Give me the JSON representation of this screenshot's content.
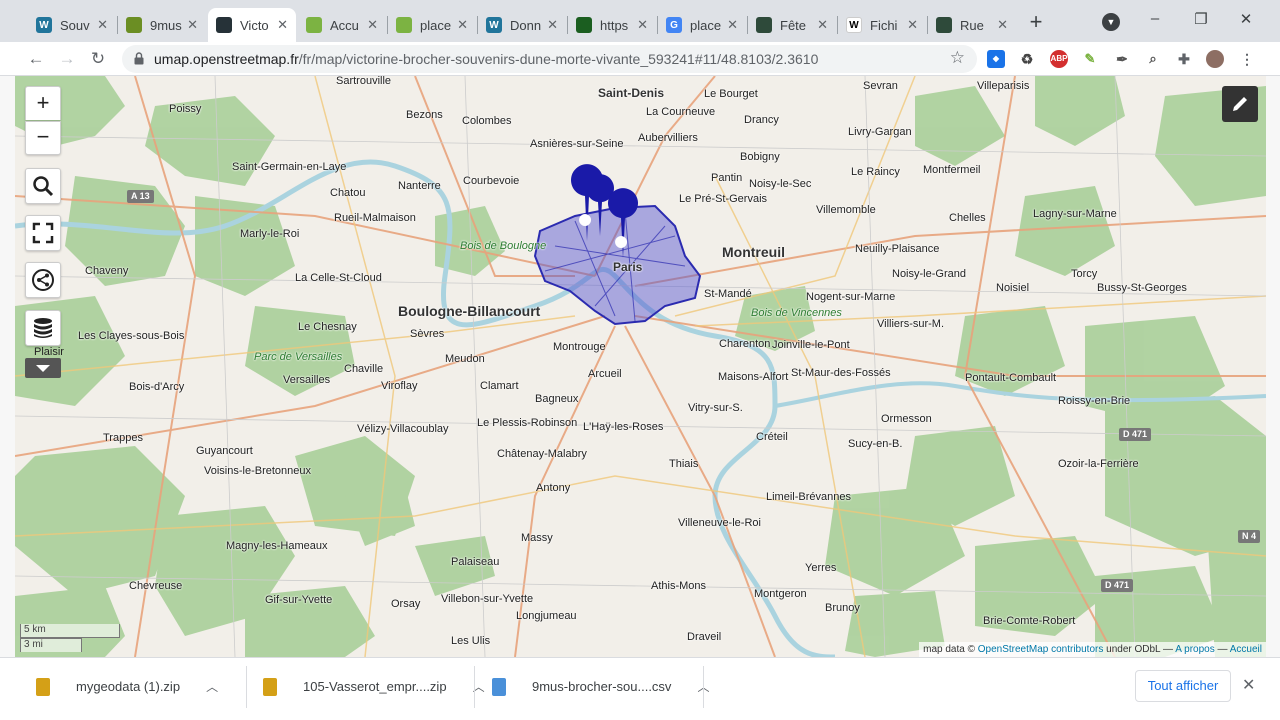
{
  "tabs": [
    {
      "title": "Souv",
      "icon": "wordpress-icon",
      "color": "#21759b",
      "glyph": "W",
      "active": false
    },
    {
      "title": "9mus",
      "icon": "spreadsheet-icon",
      "color": "#6b8e23",
      "glyph": "",
      "active": false
    },
    {
      "title": "Victo",
      "icon": "umap-icon",
      "color": "#263238",
      "glyph": "",
      "active": true
    },
    {
      "title": "Accu",
      "icon": "pin-icon",
      "color": "#7cb342",
      "glyph": "",
      "active": false
    },
    {
      "title": "place",
      "icon": "pin-icon",
      "color": "#7cb342",
      "glyph": "",
      "active": false
    },
    {
      "title": "Donn",
      "icon": "wordpress-icon",
      "color": "#21759b",
      "glyph": "W",
      "active": false
    },
    {
      "title": "https",
      "icon": "check-icon",
      "color": "#1b5e20",
      "glyph": "",
      "active": false
    },
    {
      "title": "place",
      "icon": "google-icon",
      "color": "#4285f4",
      "glyph": "G",
      "active": false
    },
    {
      "title": "Fête",
      "icon": "site-icon",
      "color": "#2e4a3a",
      "glyph": "",
      "active": false
    },
    {
      "title": "Fichi",
      "icon": "wikipedia-icon",
      "color": "#ffffff",
      "glyph": "W",
      "active": false
    },
    {
      "title": "Rue",
      "icon": "site-icon",
      "color": "#2e4a3a",
      "glyph": "",
      "active": false
    }
  ],
  "toolbar": {
    "url_host": "umap.openstreetmap.fr",
    "url_path": "/fr/map/victorine-brocher-souvenirs-dune-morte-vivante_593241#11/48.8103/2.3610",
    "abp_label": "ABP"
  },
  "map": {
    "zoom_in": "+",
    "zoom_out": "−",
    "plaisir": "Plaisir",
    "scale_km": "5 km",
    "scale_mi": "3 mi",
    "attribution": {
      "prefix": "map data © ",
      "osm": "OpenStreetMap contributors",
      "license": " under ODbL — ",
      "about": "A propos",
      "sep": " — ",
      "home": "Accueil"
    },
    "places": [
      {
        "name": "Saint-Denis",
        "cls": "mid"
      },
      {
        "name": "Le Bourget",
        "cls": ""
      },
      {
        "name": "Sevran",
        "cls": ""
      },
      {
        "name": "Villeparisis",
        "cls": ""
      },
      {
        "name": "Sartrouville",
        "cls": ""
      },
      {
        "name": "Poissy",
        "cls": ""
      },
      {
        "name": "Bezons",
        "cls": ""
      },
      {
        "name": "Colombes",
        "cls": ""
      },
      {
        "name": "La Courneuve",
        "cls": ""
      },
      {
        "name": "Drancy",
        "cls": ""
      },
      {
        "name": "Aubervilliers",
        "cls": ""
      },
      {
        "name": "Livry-Gargan",
        "cls": ""
      },
      {
        "name": "Asnières-sur-Seine",
        "cls": ""
      },
      {
        "name": "Bobigny",
        "cls": ""
      },
      {
        "name": "Saint-Germain-en-Laye",
        "cls": ""
      },
      {
        "name": "Le Raincy",
        "cls": ""
      },
      {
        "name": "Montfermeil",
        "cls": ""
      },
      {
        "name": "Chatou",
        "cls": ""
      },
      {
        "name": "Nanterre",
        "cls": ""
      },
      {
        "name": "Courbevoie",
        "cls": ""
      },
      {
        "name": "Pantin",
        "cls": ""
      },
      {
        "name": "Noisy-le-Sec",
        "cls": ""
      },
      {
        "name": "Rueil-Malmaison",
        "cls": ""
      },
      {
        "name": "Le Pré-St-Gervais",
        "cls": ""
      },
      {
        "name": "Villemomble",
        "cls": ""
      },
      {
        "name": "Chelles",
        "cls": ""
      },
      {
        "name": "Lagny-sur-Marne",
        "cls": ""
      },
      {
        "name": "Montreuil",
        "cls": "big"
      },
      {
        "name": "Marly-le-Roi",
        "cls": ""
      },
      {
        "name": "Neuilly-Plaisance",
        "cls": ""
      },
      {
        "name": "Chaveny",
        "cls": ""
      },
      {
        "name": "Noisy-le-Grand",
        "cls": ""
      },
      {
        "name": "La Celle-St-Cloud",
        "cls": ""
      },
      {
        "name": "Torcy",
        "cls": ""
      },
      {
        "name": "Noisiel",
        "cls": ""
      },
      {
        "name": "Bussy-St-Georges",
        "cls": ""
      },
      {
        "name": "Boulogne-Billancourt",
        "cls": "big"
      },
      {
        "name": "St-Mandé",
        "cls": ""
      },
      {
        "name": "Nogent-sur-Marne",
        "cls": ""
      },
      {
        "name": "Le Chesnay",
        "cls": ""
      },
      {
        "name": "Sèvres",
        "cls": ""
      },
      {
        "name": "Villiers-sur-M.",
        "cls": ""
      },
      {
        "name": "Les Clayes-sous-Bois",
        "cls": ""
      },
      {
        "name": "Montrouge",
        "cls": ""
      },
      {
        "name": "Charenton",
        "cls": ""
      },
      {
        "name": "Joinville-le-Pont",
        "cls": ""
      },
      {
        "name": "Meudon",
        "cls": ""
      },
      {
        "name": "Chaville",
        "cls": ""
      },
      {
        "name": "Versailles",
        "cls": ""
      },
      {
        "name": "Viroflay",
        "cls": ""
      },
      {
        "name": "Arcueil",
        "cls": ""
      },
      {
        "name": "Maisons-Alfort",
        "cls": ""
      },
      {
        "name": "St-Maur-des-Fossés",
        "cls": ""
      },
      {
        "name": "Pontault-Combault",
        "cls": ""
      },
      {
        "name": "Roissy-en-Brie",
        "cls": ""
      },
      {
        "name": "Bois-d'Arcy",
        "cls": ""
      },
      {
        "name": "Clamart",
        "cls": ""
      },
      {
        "name": "Bagneux",
        "cls": ""
      },
      {
        "name": "Vitry-sur-S.",
        "cls": ""
      },
      {
        "name": "Trappes",
        "cls": ""
      },
      {
        "name": "Vélizy-Villacoublay",
        "cls": ""
      },
      {
        "name": "Le Plessis-Robinson",
        "cls": ""
      },
      {
        "name": "L'Haÿ-les-Roses",
        "cls": ""
      },
      {
        "name": "Créteil",
        "cls": ""
      },
      {
        "name": "Sucy-en-B.",
        "cls": ""
      },
      {
        "name": "Ormesson",
        "cls": ""
      },
      {
        "name": "Guyancourt",
        "cls": ""
      },
      {
        "name": "Voisins-le-Bretonneux",
        "cls": ""
      },
      {
        "name": "Châtenay-Malabry",
        "cls": ""
      },
      {
        "name": "Thiais",
        "cls": ""
      },
      {
        "name": "Ozoir-la-Ferrière",
        "cls": ""
      },
      {
        "name": "Antony",
        "cls": ""
      },
      {
        "name": "Limeil-Brévannes",
        "cls": ""
      },
      {
        "name": "Villeneuve-le-Roi",
        "cls": ""
      },
      {
        "name": "Massy",
        "cls": ""
      },
      {
        "name": "Magny-les-Hameaux",
        "cls": ""
      },
      {
        "name": "Palaiseau",
        "cls": ""
      },
      {
        "name": "Athis-Mons",
        "cls": ""
      },
      {
        "name": "Yerres",
        "cls": ""
      },
      {
        "name": "Chevreuse",
        "cls": ""
      },
      {
        "name": "Gif-sur-Yvette",
        "cls": ""
      },
      {
        "name": "Orsay",
        "cls": ""
      },
      {
        "name": "Villebon-sur-Yvette",
        "cls": ""
      },
      {
        "name": "Longjumeau",
        "cls": ""
      },
      {
        "name": "Montgeron",
        "cls": ""
      },
      {
        "name": "Brunoy",
        "cls": ""
      },
      {
        "name": "Les Ulis",
        "cls": ""
      },
      {
        "name": "Draveil",
        "cls": ""
      },
      {
        "name": "Brie-Comte-Robert",
        "cls": ""
      },
      {
        "name": "Paris",
        "cls": "mid"
      },
      {
        "name": "Bois de Boulogne",
        "cls": "park"
      },
      {
        "name": "Bois de Vincennes",
        "cls": "park"
      },
      {
        "name": "Parc de Versailles",
        "cls": "park"
      },
      {
        "name": "A 13",
        "cls": "road"
      },
      {
        "name": "D 471",
        "cls": "road"
      },
      {
        "name": "D 471",
        "cls": "road"
      },
      {
        "name": "N 4",
        "cls": "road"
      }
    ]
  },
  "downloads": [
    {
      "name": "mygeodata (1).zip",
      "icon": "zip-file-icon",
      "color": "#d4a017"
    },
    {
      "name": "105-Vasserot_empr....zip",
      "icon": "zip-file-icon",
      "color": "#d4a017"
    },
    {
      "name": "9mus-brocher-sou....csv",
      "icon": "csv-file-icon",
      "color": "#4a90d9"
    }
  ],
  "download_bar": {
    "show_all": "Tout afficher"
  },
  "colors": {
    "marker": "#1a1aa8",
    "paris_poly": "#3b3bc4",
    "water": "#aad3df",
    "park": "#add19e"
  }
}
